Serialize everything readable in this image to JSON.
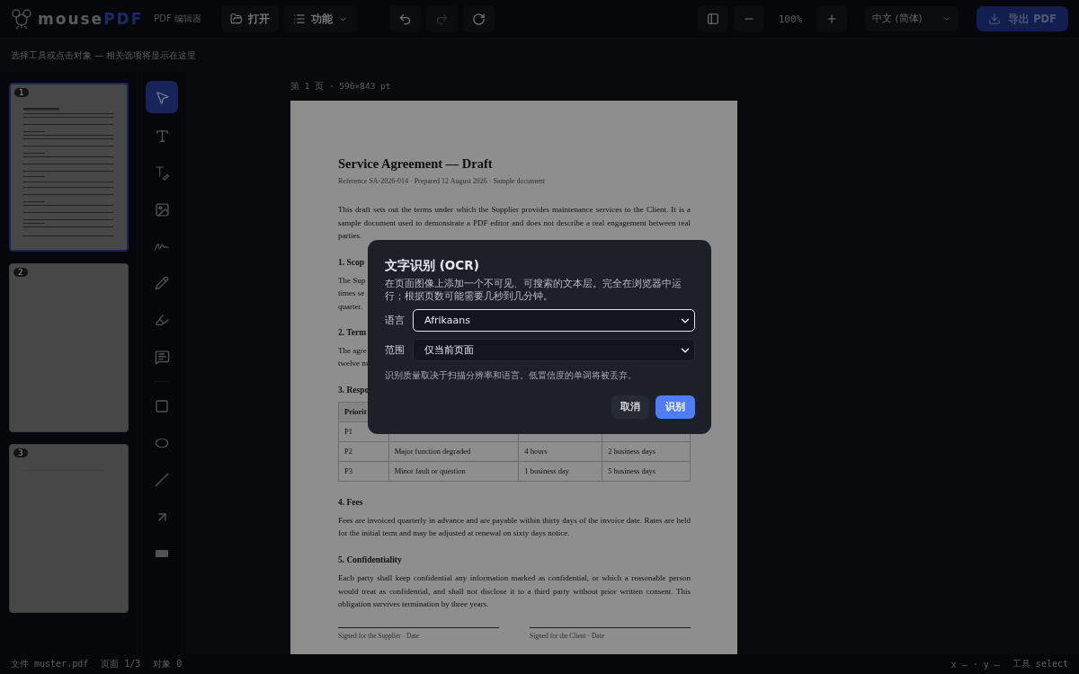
{
  "app": {
    "logo_prefix": "mouse",
    "logo_suffix": "PDF",
    "subtitle": "PDF 编辑器"
  },
  "toolbar": {
    "open": "打开",
    "features": "功能",
    "zoom": "100%",
    "language": "中文 (简体)",
    "export": "导出 PDF"
  },
  "options_hint": "选择工具或点击对象 — 相关选项将显示在这里",
  "thumbnails": [
    {
      "number": "1",
      "selected": true,
      "kind": "content"
    },
    {
      "number": "2",
      "selected": false,
      "kind": "blank"
    },
    {
      "number": "3",
      "selected": false,
      "kind": "line"
    }
  ],
  "tools": [
    {
      "kind": "select",
      "selected": true
    },
    {
      "kind": "text",
      "selected": false
    },
    {
      "kind": "edit-text",
      "selected": false
    },
    {
      "kind": "image",
      "selected": false
    },
    {
      "kind": "signature",
      "selected": false
    },
    {
      "kind": "pencil",
      "selected": false
    },
    {
      "kind": "highlighter",
      "selected": false
    },
    {
      "kind": "comment",
      "selected": false
    },
    {
      "kind": "divider"
    },
    {
      "kind": "rectangle",
      "selected": false
    },
    {
      "kind": "ellipse",
      "selected": false
    },
    {
      "kind": "line",
      "selected": false
    },
    {
      "kind": "arrow",
      "selected": false
    },
    {
      "kind": "redact",
      "selected": false
    }
  ],
  "page_label": "第 1 页 · 596×843 pt",
  "document": {
    "title": "Service Agreement — Draft",
    "subtitle": "Reference SA-2026-014 · Prepared 12 August 2026 · Sample document",
    "blocks": [
      {
        "kind": "paragraph",
        "text": "This draft sets out the terms under which the Supplier provides maintenance services to the Client. It is a sample document used to demonstrate a PDF editor and does not describe a real engagement between real parties."
      },
      {
        "kind": "heading",
        "text": "1. Scop"
      },
      {
        "kind": "lines",
        "lines": [
          "The Sup",
          "times se",
          "quarter."
        ]
      },
      {
        "kind": "heading",
        "text": "2. Term"
      },
      {
        "kind": "lines",
        "lines": [
          "The agre",
          "twelve m"
        ]
      },
      {
        "kind": "heading",
        "text": "3. Respo"
      },
      {
        "kind": "table",
        "header": [
          "Priorit"
        ],
        "rows": [
          [
            "P1"
          ],
          [
            "P2",
            "Major function degraded",
            "4 hours",
            "2 business days"
          ],
          [
            "P3",
            "Minor fault or question",
            "1 business day",
            "5 business days"
          ]
        ]
      },
      {
        "kind": "heading",
        "text": "4. Fees"
      },
      {
        "kind": "paragraph",
        "text": "Fees are invoiced quarterly in advance and are payable within thirty days of the invoice date. Rates are held for the initial term and may be adjusted at renewal on sixty days notice."
      },
      {
        "kind": "heading",
        "text": "5. Confidentiality"
      },
      {
        "kind": "paragraph",
        "text": "Each party shall keep confidential any information marked as confidential, or which a reasonable person would treat as confidential, and shall not disclose it to a third party without prior written consent. This obligation survives termination by three years."
      },
      {
        "kind": "signatures",
        "labels": [
          "Signed for the Supplier · Date",
          "Signed for the Client · Date"
        ]
      }
    ]
  },
  "status": {
    "left": [
      "文件 muster.pdf",
      "页面 1/3",
      "对象 0"
    ],
    "right": [
      "x — · y —",
      "工具 select"
    ]
  },
  "dialog": {
    "title": "文字识别 (OCR)",
    "description": "在页面图像上添加一个不可见、可搜索的文本层。完全在浏览器中运行；根据页数可能需要几秒到几分钟。",
    "fields": [
      {
        "label": "语言",
        "value": "Afrikaans",
        "focused": true
      },
      {
        "label": "范围",
        "value": "仅当前页面",
        "focused": false
      }
    ],
    "note": "识别质量取决于扫描分辨率和语言。低置信度的单词将被丢弃。",
    "cancel": "取消",
    "confirm": "识别"
  }
}
